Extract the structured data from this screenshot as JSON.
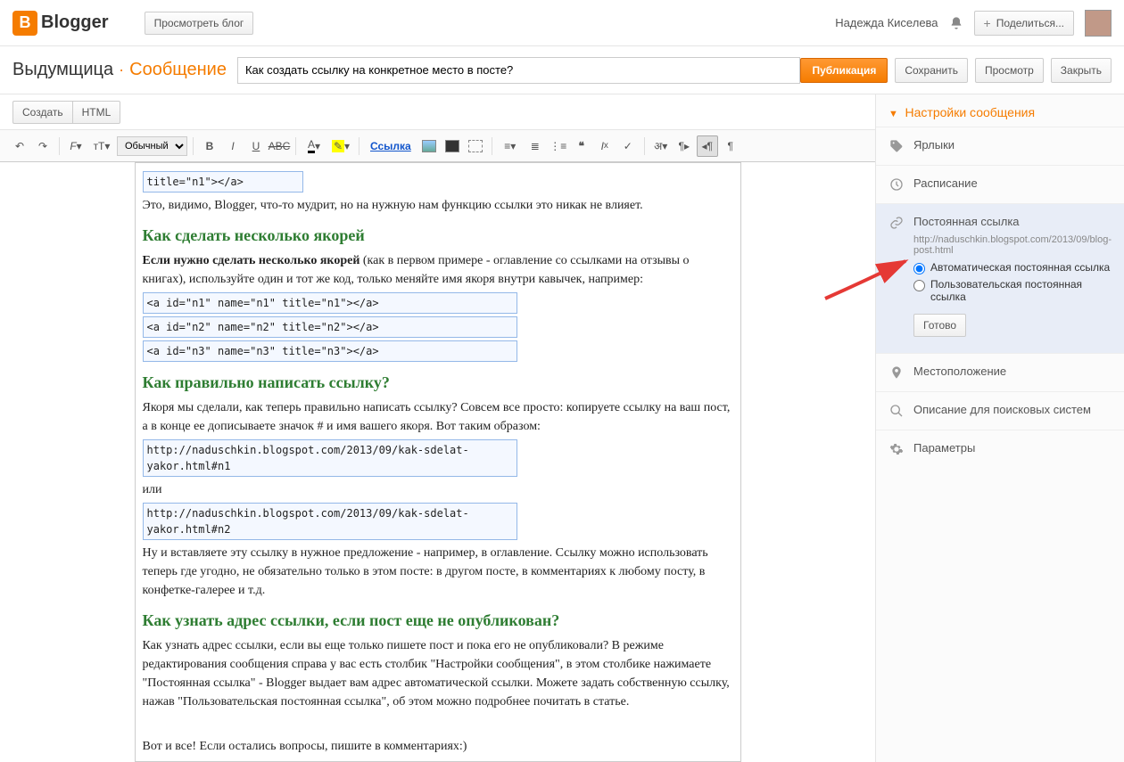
{
  "header": {
    "logo": "Blogger",
    "view_blog": "Просмотреть блог",
    "user": "Надежда Киселева",
    "share": "Поделиться..."
  },
  "title_bar": {
    "blog": "Выдумщица",
    "page": "Сообщение",
    "post_title": "Как создать ссылку на конкретное место в посте?",
    "publish": "Публикация",
    "save": "Сохранить",
    "preview": "Просмотр",
    "close": "Закрыть"
  },
  "tabs": {
    "compose": "Создать",
    "html": "HTML"
  },
  "toolbar": {
    "size_select": "Обычный",
    "link": "Ссылка"
  },
  "post": {
    "code0": "title=\"n1\"></a>",
    "p1": "Это, видимо, Blogger, что-то мудрит, но на нужную нам функцию ссылки это никак не влияет.",
    "h1": "Как сделать несколько якорей",
    "p2a": "Если нужно сделать несколько якорей",
    "p2b": " (как в первом примере - оглавление со ссылками на отзывы о книгах), используйте один и тот же код, только меняйте имя якоря внутри кавычек, например:",
    "code1": "<a id=\"n1\" name=\"n1\" title=\"n1\"></a>",
    "code2": "<a id=\"n2\" name=\"n2\" title=\"n2\"></a>",
    "code3": "<a id=\"n3\" name=\"n3\" title=\"n3\"></a>",
    "h2": "Как правильно написать ссылку?",
    "p3": "Якоря мы сделали, как теперь правильно написать ссылку? Совсем все просто: копируете ссылку на ваш пост, а в конце ее дописываете значок # и имя вашего якоря. Вот таким образом:",
    "code4": "http://naduschkin.blogspot.com/2013/09/kak-sdelat-yakor.html#n1",
    "p4": "или",
    "code5": "http://naduschkin.blogspot.com/2013/09/kak-sdelat-yakor.html#n2",
    "p5": "Ну и вставляете эту ссылку в нужное предложение - например, в оглавление. Ссылку можно использовать теперь где угодно, не обязательно только в этом посте: в другом посте, в комментариях к любому посту, в конфетке-галерее и т.д.",
    "h3": "Как узнать адрес ссылки, если пост еще не опубликован?",
    "p6": "Как узнать адрес ссылки, если вы еще только пишете пост и пока его не опубликовали? В режиме редактирования сообщения справа у вас есть столбик \"Настройки сообщения\", в этом столбике нажимаете \"Постоянная ссылка\" - Blogger выдает вам адрес автоматической ссылки. Можете задать собственную ссылку, нажав \"Пользовательская постоянная ссылка\", об этом можно подробнее почитать в статье.",
    "p7": "Вот и все! Если остались вопросы, пишите в комментариях:)"
  },
  "sidebar": {
    "title": "Настройки сообщения",
    "labels": "Ярлыки",
    "schedule": "Расписание",
    "permalink": "Постоянная ссылка",
    "permalink_url": "http://naduschkin.blogspot.com/2013/09/blog-post.html",
    "permalink_auto": "Автоматическая постоянная ссылка",
    "permalink_custom": "Пользовательская постоянная ссылка",
    "done": "Готово",
    "location": "Местоположение",
    "seo": "Описание для поисковых систем",
    "options": "Параметры"
  }
}
